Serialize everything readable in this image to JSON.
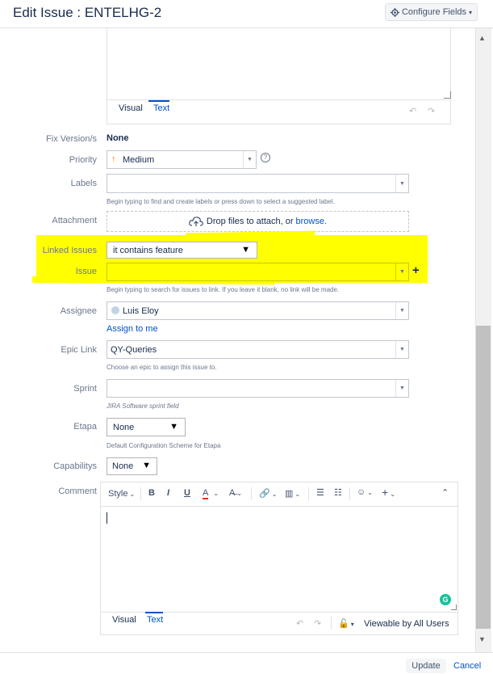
{
  "dialog": {
    "title": "Edit Issue : ENTELHG-2",
    "configure_label": "Configure Fields"
  },
  "top_editor": {
    "visual_tab": "Visual",
    "text_tab": "Text"
  },
  "fields": {
    "fix_version": {
      "label": "Fix Version/s",
      "value": "None"
    },
    "priority": {
      "label": "Priority",
      "value": "Medium",
      "arrow": "↑"
    },
    "labels": {
      "label": "Labels",
      "value": "",
      "help": "Begin typing to find and create labels or press down to select a suggested label."
    },
    "attachment": {
      "label": "Attachment",
      "drop_text": "Drop files to attach, or",
      "browse": "browse."
    },
    "linked_issues": {
      "label": "Linked Issues",
      "value": "it contains feature"
    },
    "issue": {
      "label": "Issue",
      "value": "",
      "help": "Begin typing to search for issues to link. If you leave it blank, no link will be made.",
      "add": "+"
    },
    "assignee": {
      "label": "Assignee",
      "value": "Luis Eloy",
      "assign_to_me": "Assign to me"
    },
    "epic_link": {
      "label": "Epic Link",
      "value": "QY-Queries",
      "help": "Choose an epic to assign this issue to."
    },
    "sprint": {
      "label": "Sprint",
      "value": "",
      "help": "JIRA Software sprint field"
    },
    "etapa": {
      "label": "Etapa",
      "value": "None",
      "help": "Default Configuration Scheme for Etapa"
    },
    "capabilitys": {
      "label": "Capabilitys",
      "value": "None"
    },
    "comment": {
      "label": "Comment"
    }
  },
  "comment_editor": {
    "style": "Style",
    "bold": "B",
    "italic": "I",
    "underline": "U",
    "color": "A",
    "visual_tab": "Visual",
    "text_tab": "Text",
    "viewable": "Viewable by All Users"
  },
  "footer": {
    "update": "Update",
    "cancel": "Cancel"
  },
  "colors": {
    "highlight": "#ffff00",
    "link": "#0052cc",
    "priority": "#ff8b00"
  },
  "icons": [
    "gear-icon",
    "help-icon",
    "upload-cloud-icon",
    "avatar",
    "link-icon",
    "attachment-icon",
    "bullet-list-icon",
    "numbered-list-icon",
    "emoji-icon",
    "insert-icon",
    "collapse-icon",
    "undo-icon",
    "redo-icon",
    "lock-icon",
    "grammarly-icon"
  ]
}
